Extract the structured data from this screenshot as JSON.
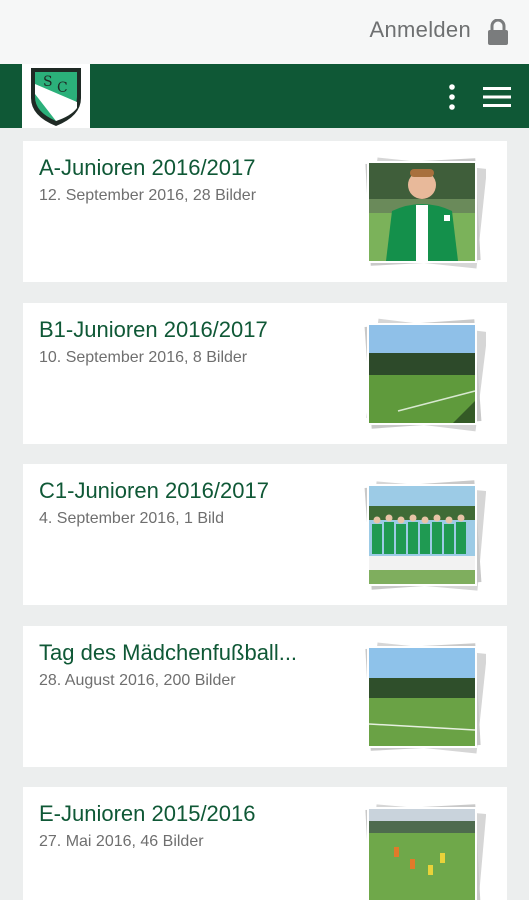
{
  "header": {
    "login_label": "Anmelden",
    "lock_icon": "lock-icon",
    "logo_icon": "club-crest-logo",
    "overflow_icon": "more-vertical-icon",
    "menu_icon": "hamburger-menu-icon"
  },
  "colors": {
    "brand_green": "#0f5836",
    "background": "#eceeee",
    "card": "#ffffff",
    "meta_text": "#6f6f6f"
  },
  "albums": [
    {
      "title": "A-Junioren 2016/2017",
      "meta": "12. September 2016, 28 Bilder",
      "thumb": "player-portrait"
    },
    {
      "title": "B1-Junioren 2016/2017",
      "meta": "10. September 2016, 8 Bilder",
      "thumb": "football-field"
    },
    {
      "title": "C1-Junioren 2016/2017",
      "meta": "4. September 2016, 1 Bild",
      "thumb": "team-photo"
    },
    {
      "title": "Tag des Mädchenfußball...",
      "meta": "28. August 2016, 200 Bilder",
      "thumb": "football-field"
    },
    {
      "title": "E-Junioren 2015/2016",
      "meta": "27. Mai 2016, 46 Bilder",
      "thumb": "kids-training"
    }
  ]
}
